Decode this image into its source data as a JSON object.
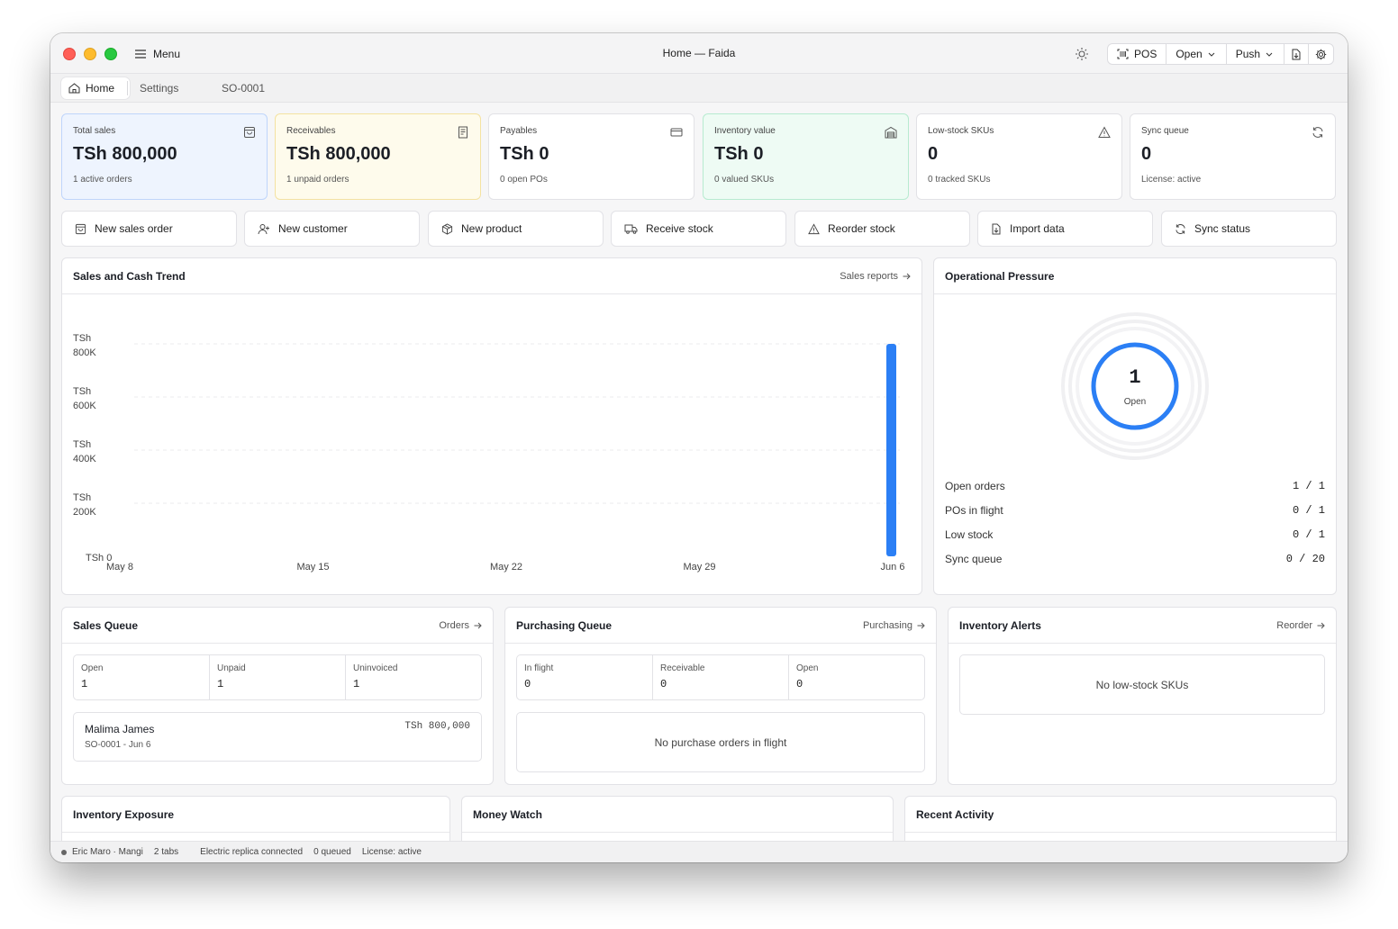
{
  "window": {
    "title": "Home — Faida",
    "menu_label": "Menu"
  },
  "toolbar": {
    "pos_label": "POS",
    "open_label": "Open",
    "push_label": "Push"
  },
  "tabs": [
    {
      "label": "Home"
    },
    {
      "label": "Settings"
    },
    {
      "label": "SO-0001"
    }
  ],
  "stats": [
    {
      "label": "Total sales",
      "value": "TSh 800,000",
      "sub": "1 active orders",
      "icon": "bag-icon",
      "bg": "#eef4fe",
      "border": "#bfd5fb"
    },
    {
      "label": "Receivables",
      "value": "TSh 800,000",
      "sub": "1 unpaid orders",
      "icon": "receipt-icon",
      "bg": "#fefbec",
      "border": "#f4e2a1"
    },
    {
      "label": "Payables",
      "value": "TSh 0",
      "sub": "0 open POs",
      "icon": "card-icon",
      "bg": "#ffffff",
      "border": "#e2e2e6"
    },
    {
      "label": "Inventory value",
      "value": "TSh 0",
      "sub": "0 valued SKUs",
      "icon": "warehouse-icon",
      "bg": "#eefbf4",
      "border": "#b7ebd0"
    },
    {
      "label": "Low-stock SKUs",
      "value": "0",
      "sub": "0 tracked SKUs",
      "icon": "warning-icon",
      "bg": "#ffffff",
      "border": "#e2e2e6"
    },
    {
      "label": "Sync queue",
      "value": "0",
      "sub": "License: active",
      "icon": "refresh-icon",
      "bg": "#ffffff",
      "border": "#e2e2e6"
    }
  ],
  "actions": [
    {
      "label": "New sales order",
      "icon": "bag-icon"
    },
    {
      "label": "New customer",
      "icon": "user-plus-icon"
    },
    {
      "label": "New product",
      "icon": "package-icon"
    },
    {
      "label": "Receive stock",
      "icon": "truck-icon"
    },
    {
      "label": "Reorder stock",
      "icon": "warning-icon"
    },
    {
      "label": "Import data",
      "icon": "file-import-icon"
    },
    {
      "label": "Sync status",
      "icon": "refresh-icon"
    }
  ],
  "trend": {
    "title": "Sales and Cash Trend",
    "link": "Sales reports"
  },
  "chart_data": {
    "type": "bar",
    "x": [
      "May 8",
      "May 15",
      "May 22",
      "May 29",
      "Jun 6"
    ],
    "series": [
      {
        "values": [
          0,
          0,
          0,
          0,
          800000
        ],
        "color": "#2b7ff5"
      }
    ],
    "y_ticks": [
      "TSh 800K",
      "TSh 600K",
      "TSh 400K",
      "TSh 200K",
      "TSh 0"
    ],
    "ylim": [
      0,
      800000
    ],
    "grid": true
  },
  "pressure": {
    "title": "Operational Pressure",
    "ring_value": "1",
    "ring_label": "Open",
    "ring_fraction": 1.0,
    "rows": [
      {
        "label": "Open orders",
        "value": "1 / 1"
      },
      {
        "label": "POs in flight",
        "value": "0 / 1"
      },
      {
        "label": "Low stock",
        "value": "0 / 1"
      },
      {
        "label": "Sync queue",
        "value": "0 / 20"
      }
    ]
  },
  "sales_queue": {
    "title": "Sales Queue",
    "link": "Orders",
    "cells": [
      {
        "label": "Open",
        "value": "1"
      },
      {
        "label": "Unpaid",
        "value": "1"
      },
      {
        "label": "Uninvoiced",
        "value": "1"
      }
    ],
    "order": {
      "customer": "Malima James",
      "meta": "SO-0001 - Jun 6",
      "amount": "TSh 800,000"
    }
  },
  "purchasing_queue": {
    "title": "Purchasing Queue",
    "link": "Purchasing",
    "cells": [
      {
        "label": "In flight",
        "value": "0"
      },
      {
        "label": "Receivable",
        "value": "0"
      },
      {
        "label": "Open",
        "value": "0"
      }
    ],
    "empty": "No purchase orders in flight"
  },
  "inventory_alerts": {
    "title": "Inventory Alerts",
    "link": "Reorder",
    "empty": "No low-stock SKUs"
  },
  "bottom_panels": {
    "exposure": "Inventory Exposure",
    "money": "Money Watch",
    "activity": "Recent Activity"
  },
  "statusbar": {
    "user": "Eric Maro · Mangi",
    "tabs": "2 tabs",
    "replica": "Electric replica connected",
    "queued": "0 queued",
    "license": "License: active"
  },
  "colors": {
    "accent": "#2b7ff5"
  }
}
